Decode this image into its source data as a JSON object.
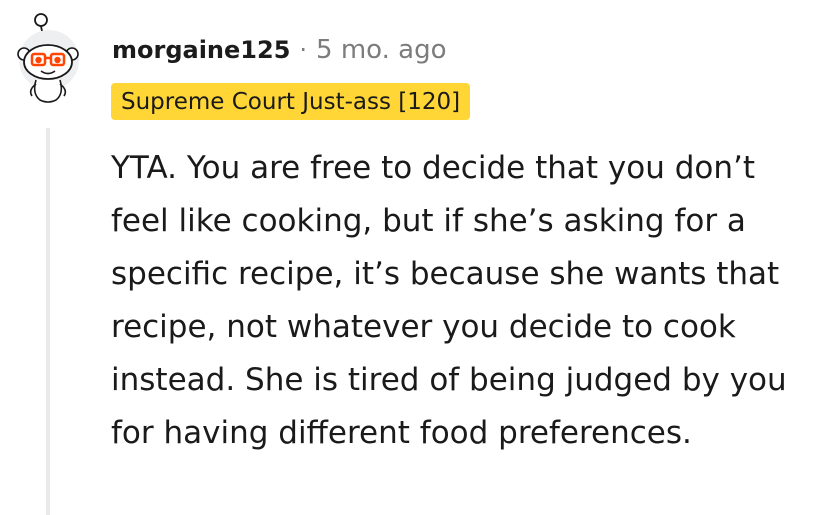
{
  "comment": {
    "author": "morgaine125",
    "separator": "·",
    "timestamp": "5 mo. ago",
    "flair": "Supreme Court Just-ass [120]",
    "body": "YTA. You are free to decide that you don’t feel like cooking, but if she’s asking for a specific recipe, it’s because she wants that recipe, not whatever you decide to cook instead. She is tired of being judged by you for having different food preferences."
  },
  "avatar": {
    "icon": "snoo-avatar-icon",
    "glasses_color": "#ff4500",
    "eye_color": "#ff4500"
  },
  "colors": {
    "flair_background": "#ffd635",
    "meta_text": "#7c7c7c",
    "thread_line": "#e8e9ea"
  }
}
